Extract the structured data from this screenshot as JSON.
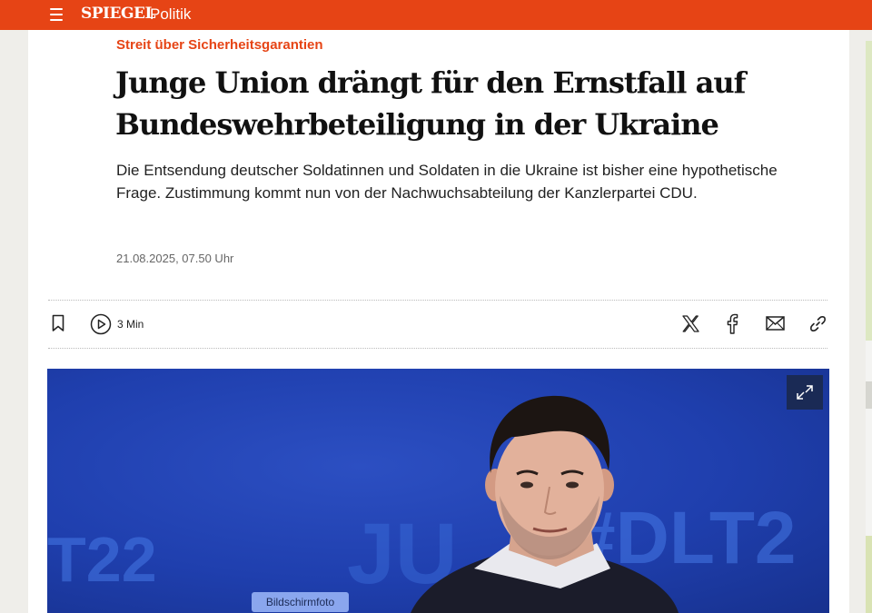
{
  "header": {
    "logo": "SPIEGEL",
    "section": "Politik",
    "menu_icon": "hamburger-menu-icon"
  },
  "article": {
    "kicker": "Streit über Sicherheitsgarantien",
    "headline": "Junge Union drängt für den Ernstfall auf Bundeswehrbeteiligung in der Ukraine",
    "lead": "Die Entsendung deutscher Soldatinnen und Soldaten in die Ukraine ist bisher eine hypothetische Frage. Zustimmung kommt nun von der Nachwuchsabteilung der Kanzlerpartei CDU.",
    "date": "21.08.2025, 07.50 Uhr"
  },
  "toolbar": {
    "read_time": "3 Min",
    "icons": [
      "bookmark-icon",
      "play-icon",
      "x-icon",
      "facebook-icon",
      "mail-icon",
      "link-icon"
    ]
  },
  "hero": {
    "background_text_left": "T22",
    "background_text_right": "#DLT2",
    "background_text_mid": "JU",
    "caption": "Bildschirmfoto",
    "expand_icon": "expand-icon"
  },
  "colors": {
    "brand": "#e64415",
    "kicker": "#e64415",
    "hero_blue": "#1f3fae"
  }
}
